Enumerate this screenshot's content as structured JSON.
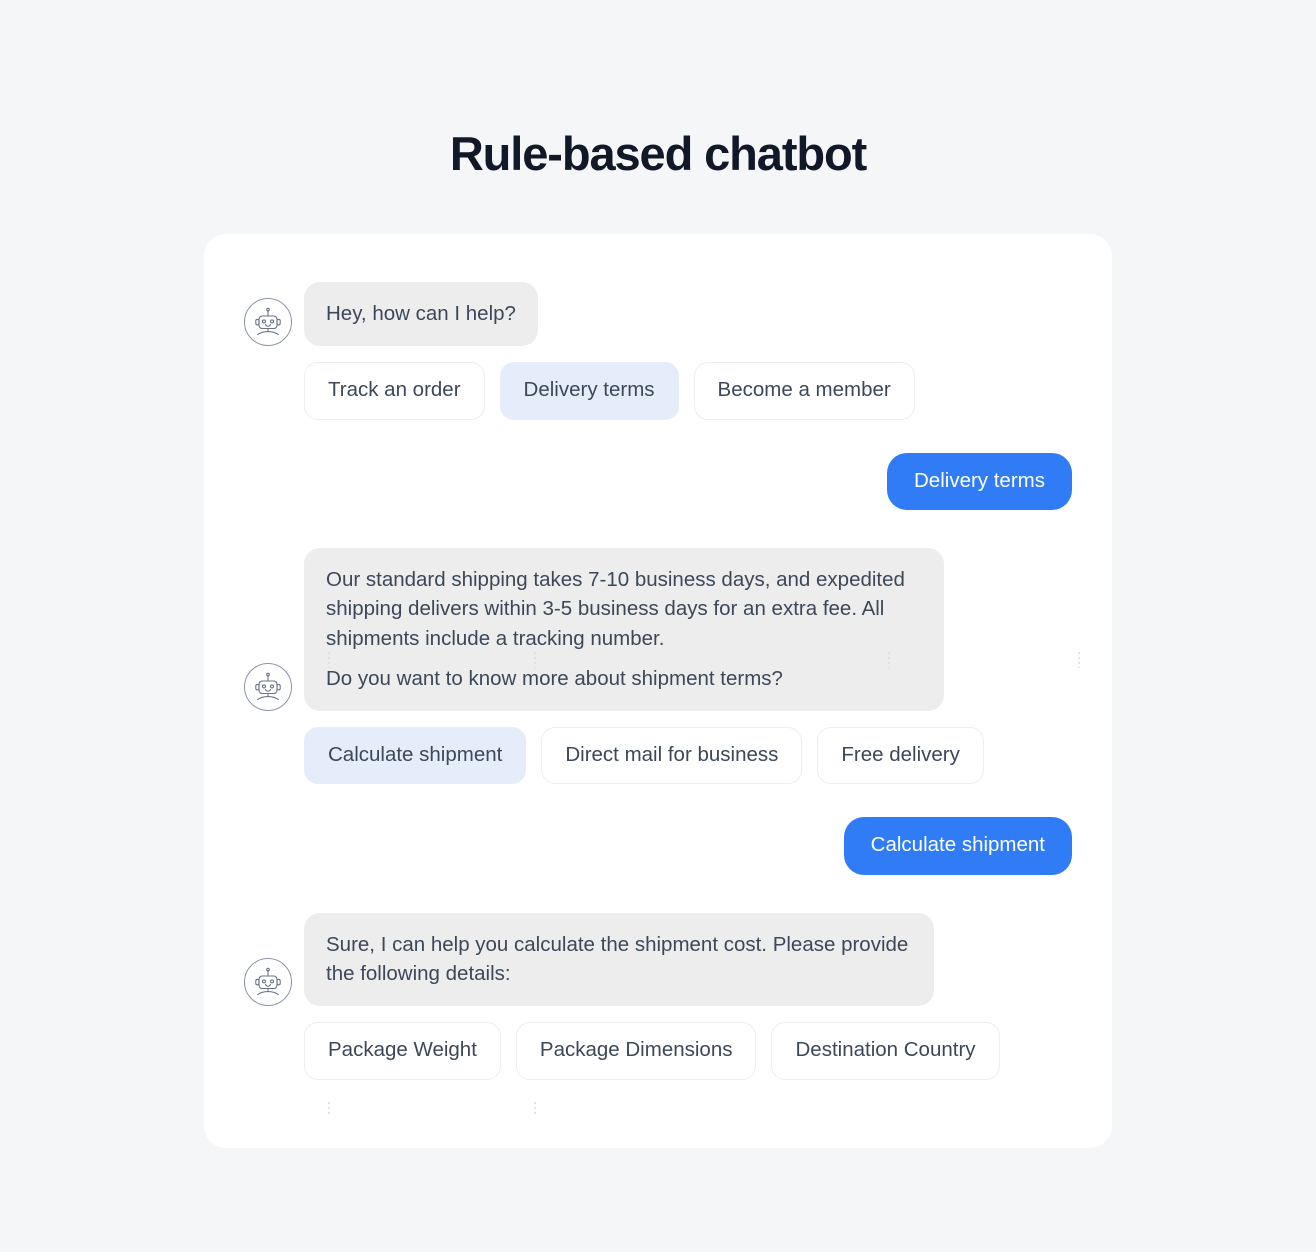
{
  "page": {
    "title": "Rule-based chatbot",
    "background_color": "#f5f6f8",
    "card_background": "#ffffff"
  },
  "colors": {
    "user_bubble": "#2f7cf6",
    "bot_bubble": "#ededee",
    "chip_selected": "#e5edfb",
    "chip_border": "#eceef2",
    "text": "#3c4858",
    "title": "#111827"
  },
  "avatar": {
    "icon": "robot-face-icon",
    "alt": "Chatbot avatar"
  },
  "conversation": {
    "turn1": {
      "bot_message": "Hey, how can I help?",
      "chips": [
        {
          "label": "Track an order",
          "selected": false
        },
        {
          "label": "Delivery terms",
          "selected": true
        },
        {
          "label": "Become a member",
          "selected": false
        }
      ],
      "user_reply": "Delivery terms"
    },
    "turn2": {
      "bot_message_p1": "Our standard shipping takes 7-10 business days, and expedited shipping delivers within 3-5 business days for an extra fee. All shipments include a tracking number.",
      "bot_message_p2": "Do you want to know more about shipment terms?",
      "chips": [
        {
          "label": "Calculate shipment",
          "selected": true
        },
        {
          "label": "Direct mail for business",
          "selected": false
        },
        {
          "label": "Free delivery",
          "selected": false
        }
      ],
      "user_reply": "Calculate shipment"
    },
    "turn3": {
      "bot_message": "Sure, I can help you calculate the shipment cost. Please provide the following details:",
      "chips": [
        {
          "label": "Package Weight",
          "selected": false
        },
        {
          "label": "Package Dimensions",
          "selected": false
        },
        {
          "label": "Destination Country",
          "selected": false
        }
      ]
    }
  }
}
